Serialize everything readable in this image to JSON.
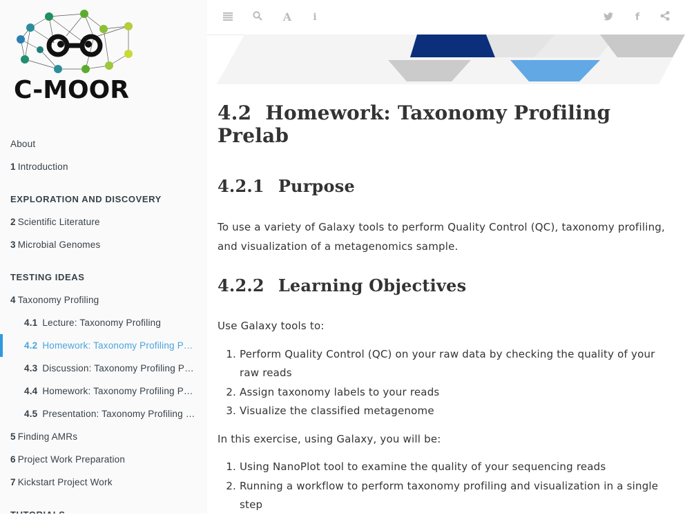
{
  "logo": {
    "text": "C-MOOR"
  },
  "toc": {
    "about": "About",
    "intro": {
      "num": "1",
      "label": "Introduction"
    },
    "section1": "EXPLORATION AND DISCOVERY",
    "ch2": {
      "num": "2",
      "label": "Scientific Literature"
    },
    "ch3": {
      "num": "3",
      "label": "Microbial Genomes"
    },
    "section2": "TESTING IDEAS",
    "ch4": {
      "num": "4",
      "label": "Taxonomy Profiling"
    },
    "s41": {
      "num": "4.1",
      "label": "Lecture: Taxonomy Profiling"
    },
    "s42": {
      "num": "4.2",
      "label": "Homework: Taxonomy Profiling Prelab"
    },
    "s43": {
      "num": "4.3",
      "label": "Discussion: Taxonomy Profiling Prelab"
    },
    "s44": {
      "num": "4.4",
      "label": "Homework: Taxonomy Profiling Practice"
    },
    "s45": {
      "num": "4.5",
      "label": "Presentation: Taxonomy Profiling Results"
    },
    "ch5": {
      "num": "5",
      "label": "Finding AMRs"
    },
    "ch6": {
      "num": "6",
      "label": "Project Work Preparation"
    },
    "ch7": {
      "num": "7",
      "label": "Kickstart Project Work"
    },
    "section3": "TUTORIALS"
  },
  "main": {
    "h1_num": "4.2",
    "h1_text": "Homework: Taxonomy Profiling Prelab",
    "h2a_num": "4.2.1",
    "h2a_text": "Purpose",
    "purpose_text": "To use a variety of Galaxy tools to perform Quality Control (QC), taxonomy profiling, and visualization of a metagenomics sample.",
    "h2b_num": "4.2.2",
    "h2b_text": "Learning Objectives",
    "use_galaxy": "Use Galaxy tools to:",
    "objectives": [
      "Perform Quality Control (QC) on your raw data by checking the quality of your raw reads",
      "Assign taxonomy labels to your reads",
      "Visualize the classified metagenome"
    ],
    "exercise_intro": "In this exercise, using Galaxy, you will be:",
    "steps": [
      "Using NanoPlot tool to examine the quality of your sequencing reads",
      "Running a workflow to perform taxonomy profiling and visualization in a single step"
    ]
  },
  "icons": [
    "menu-icon",
    "search-icon",
    "font-icon",
    "info-icon",
    "twitter-icon",
    "facebook-icon",
    "share-icon"
  ],
  "colors": {
    "link": "#364149",
    "active": "#4aa3df",
    "banner_dark": "#0b2f7a",
    "banner_blue": "#5aa7e6"
  }
}
